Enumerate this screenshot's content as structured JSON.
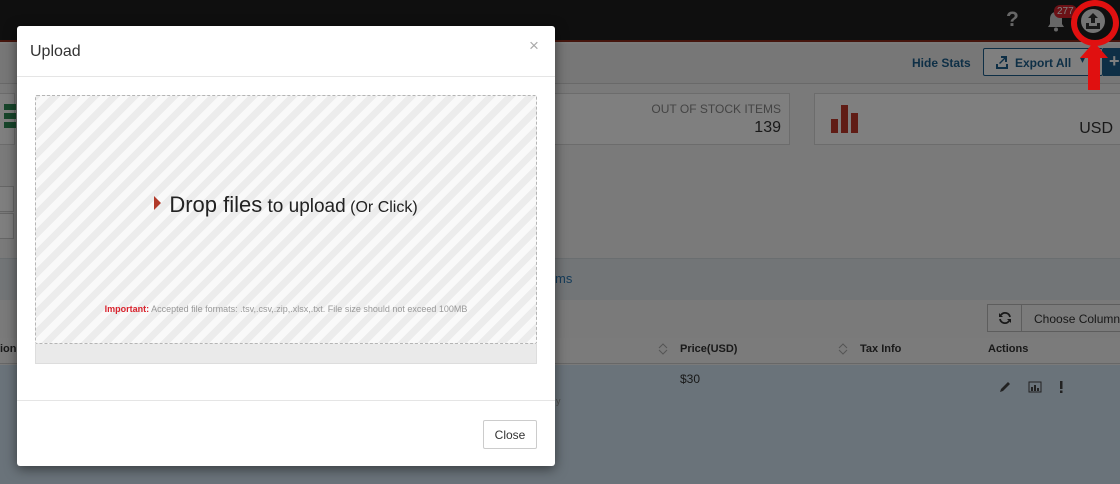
{
  "topbar": {
    "notification_count": "277",
    "colors": {
      "bar": "#1f1f1f",
      "badge": "#d9232d",
      "annotation": "#e01010"
    }
  },
  "toolbar": {
    "hide_stats_label": "Hide Stats",
    "export_label": "Export All"
  },
  "stats": {
    "out_of_stock_label": "OUT OF STOCK ITEMS",
    "out_of_stock_value": "139",
    "currency_label": "USD"
  },
  "filters": {
    "items_link_partial": "ms"
  },
  "table": {
    "choose_columns_label": "Choose Columns",
    "headers": {
      "col_left_partial": "ion",
      "price": "Price(USD)",
      "tax": "Tax Info",
      "actions": "Actions"
    },
    "rows": [
      {
        "price": "$30",
        "faint_partial": "y"
      }
    ]
  },
  "modal": {
    "title": "Upload",
    "close_x": "×",
    "drop_strong": "Drop files",
    "drop_mid": " to upload",
    "drop_small": " (Or Click)",
    "note_important": "Important:",
    "note_text": " Accepted file formats: .tsv,.csv,.zip,.xlsx,.txt. File size should not exceed 100MB",
    "upload_progress": 0,
    "close_button_label": "Close"
  }
}
